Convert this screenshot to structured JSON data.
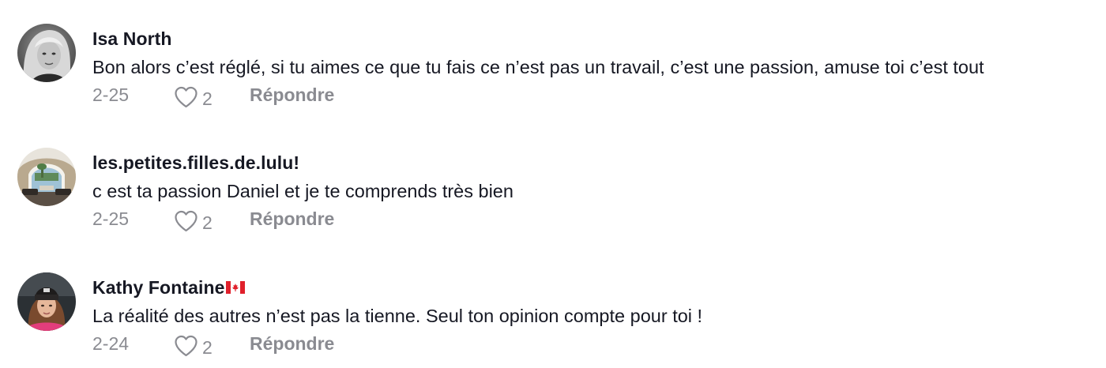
{
  "comments": [
    {
      "username": "Isa North",
      "text": "Bon alors c’est réglé, si tu aimes ce que tu fais ce n’est pas un travail, c’est une passion, amuse toi c’est tout",
      "date": "2-25",
      "likes": "2",
      "reply_label": "Répondre",
      "avatar": "woman-blonde-grayscale-photo"
    },
    {
      "username": "les.petites.filles.de.lulu!",
      "text": "c est ta passion Daniel et je te comprends très bien",
      "date": "2-25",
      "likes": "2",
      "reply_label": "Répondre",
      "avatar": "interior-archway-photo"
    },
    {
      "username": "Kathy Fontaine",
      "flag": "canada-flag",
      "text": "La réalité des autres n’est pas la tienne. Seul ton opinion compte pour toi !",
      "date": "2-24",
      "likes": "2",
      "reply_label": "Répondre",
      "avatar": "woman-beanie-pink-jacket-photo"
    }
  ],
  "colors": {
    "primary_text": "#161823",
    "secondary_text": "#8a8b91",
    "background": "#ffffff"
  }
}
